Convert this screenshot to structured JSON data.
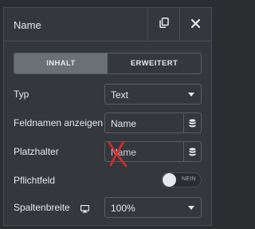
{
  "header": {
    "title": "Name",
    "copy_icon": "copy-icon",
    "close_icon": "close-icon"
  },
  "tabs": [
    {
      "label": "INHALT",
      "active": true
    },
    {
      "label": "ERWEITERT",
      "active": false
    }
  ],
  "fields": {
    "typ": {
      "label": "Typ",
      "value": "Text"
    },
    "feldnamen": {
      "label": "Feldnamen anzeigen",
      "value": "Name",
      "icon": "database-icon"
    },
    "platzhalter": {
      "label": "Platzhalter",
      "placeholder": "Name",
      "icon": "database-icon"
    },
    "pflichtfeld": {
      "label": "Pflichtfeld",
      "toggle_text": "NEIN",
      "on": false
    },
    "spaltenbreite": {
      "label": "Spaltenbreite",
      "value": "100%",
      "icon": "monitor-icon"
    }
  },
  "annotation": {
    "icon": "red-x-mark",
    "color": "#d62b2b"
  },
  "colors": {
    "background": "#2b2d31",
    "panel": "#34373c",
    "border": "#4a4e55",
    "tab_active": "#6b6f76",
    "text": "#e6e8eb"
  }
}
